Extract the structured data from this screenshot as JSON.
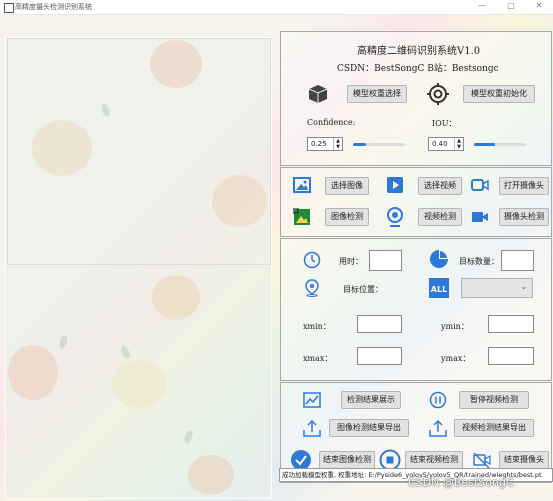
{
  "window": {
    "title": "高精度摄头检测识别系统",
    "minimize": "—",
    "maximize": "□",
    "close": "✕"
  },
  "header": {
    "title": "高精度二维码识别系统V1.0",
    "subtitle": "CSDN：BestSongC   B站：Bestsongc"
  },
  "model": {
    "select_button": "模型权重选择",
    "init_button": "模型权重初始化"
  },
  "params": {
    "confidence_label": "Confidence:",
    "confidence_value": "0.25",
    "confidence_level": 0.25,
    "iou_label": "IOU：",
    "iou_value": "0.40",
    "iou_level": 0.4
  },
  "media": {
    "select_image": "选择图像",
    "select_video": "选择视频",
    "open_camera": "打开摄像头",
    "image_detect": "图像检测",
    "video_detect": "视频检测",
    "camera_detect": "摄像头检测"
  },
  "info": {
    "time_label": "用时：",
    "time_value": "",
    "count_label": "目标数量：",
    "count_value": "",
    "position_label": "目标位置：",
    "position_select": "",
    "xmin_label": "xmin：",
    "ymin_label": "ymin：",
    "xmax_label": "xmax：",
    "ymax_label": "ymax："
  },
  "actions": {
    "show_result": "检测结果展示",
    "pause_video": "暂停视频检测",
    "export_image": "图像检测结果导出",
    "export_video": "视频检测结果导出",
    "stop_image": "结束图像检测",
    "stop_video": "结束视频检测",
    "stop_camera": "结束摄像头"
  },
  "status": {
    "text": "成功加载模型权重, 权重地址: E:/Pyside6_yolov5/yolov5_QR/trained/wieghts/best.pt"
  },
  "watermark": "CSDN @BestSongC",
  "colors": {
    "accent": "#2d7ad6",
    "icon_dark": "#1e3a5f"
  }
}
